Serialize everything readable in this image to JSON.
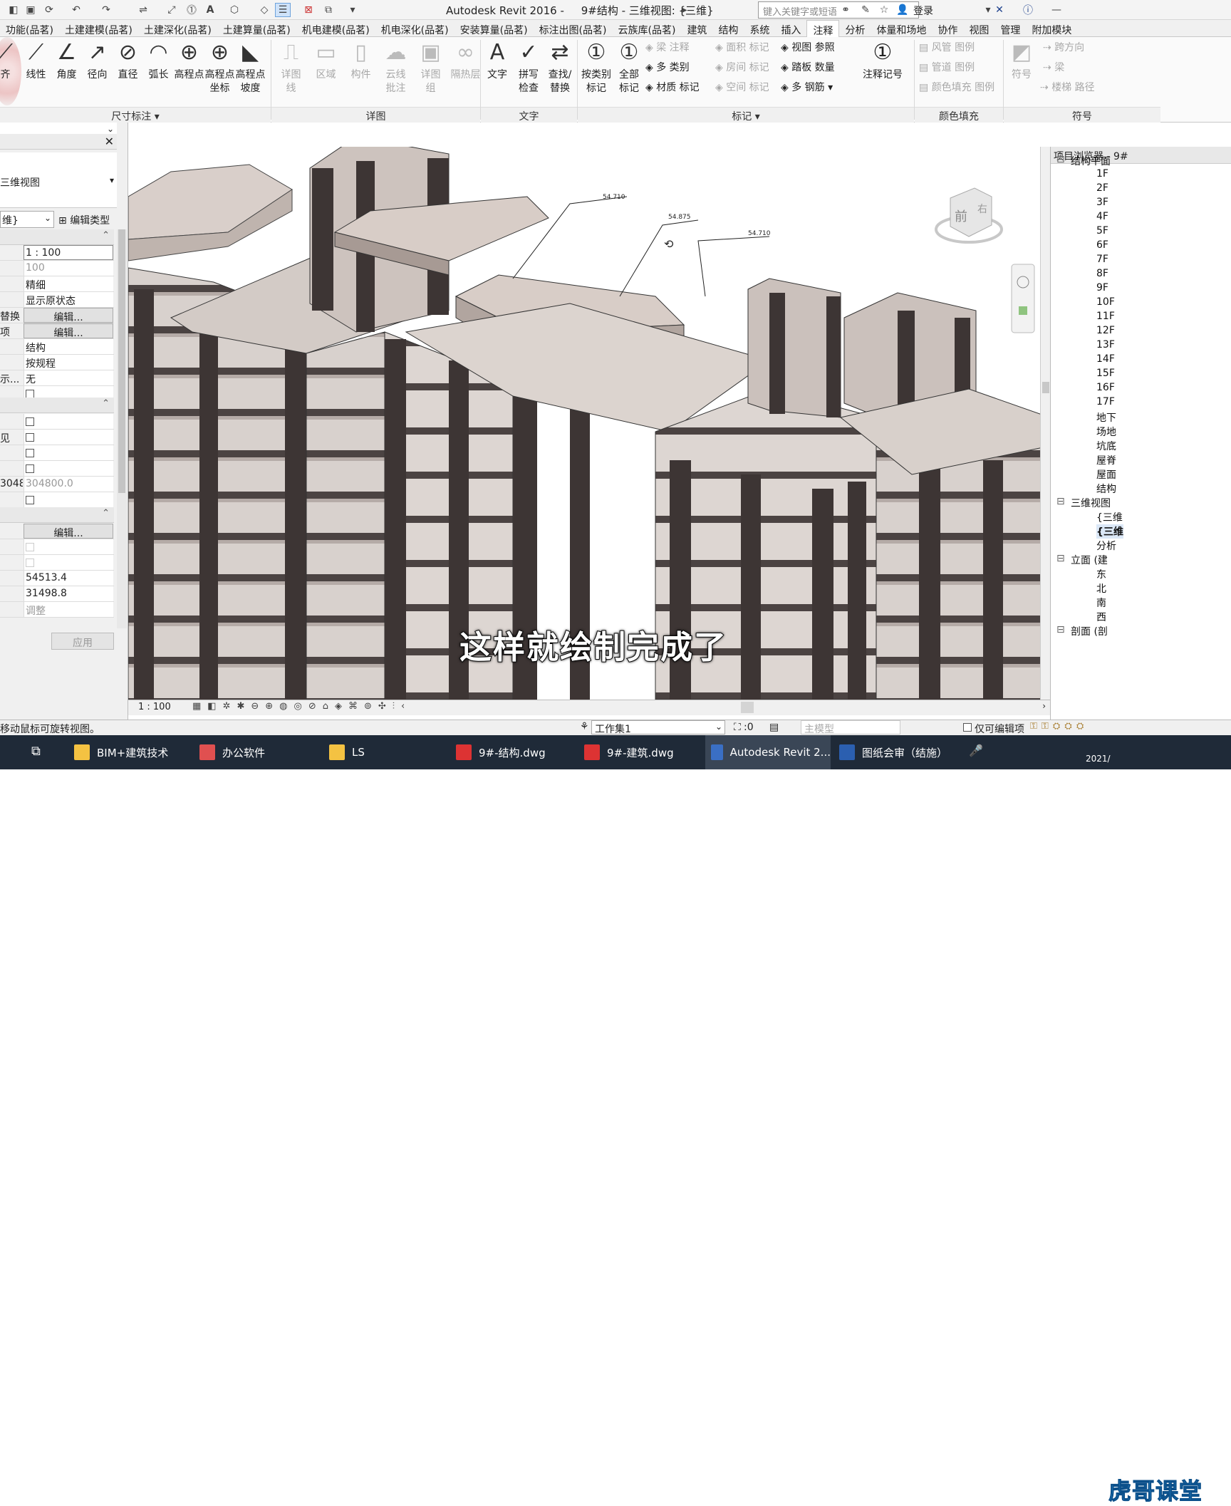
{
  "titlebar": {
    "title": "Autodesk Revit 2016 -     9#结构 - 三维视图: {三维}",
    "search_placeholder": "键入关键字或短语",
    "login_label": "登录"
  },
  "tabs": [
    "功能(品茗)",
    "土建建模(品茗)",
    "土建深化(品茗)",
    "土建算量(品茗)",
    "机电建模(品茗)",
    "机电深化(品茗)",
    "安装算量(品茗)",
    "标注出图(品茗)",
    "云族库(品茗)",
    "建筑",
    "结构",
    "系统",
    "插入",
    "注释",
    "分析",
    "体量和场地",
    "协作",
    "视图",
    "管理",
    "附加模块"
  ],
  "active_tab": "注释",
  "ribbon": {
    "dimension": {
      "buttons": [
        "齐",
        "线性",
        "角度",
        "径向",
        "直径",
        "弧长",
        "高程点",
        "高程点\n坐标",
        "高程点\n坡度"
      ],
      "panel_label": "尺寸标注 ▾"
    },
    "detail": {
      "buttons": [
        "详图\n线",
        "区域",
        "构件",
        "云线\n批注",
        "详图\n组",
        "隔热层"
      ],
      "panel_label": "详图"
    },
    "text": {
      "buttons": [
        "文字",
        "拼写\n检查",
        "查找/\n替换"
      ],
      "panel_label": "文字"
    },
    "tag": {
      "buttons": [
        "按类别\n标记",
        "全部\n标记"
      ],
      "small_a": [
        "梁 注释",
        "多 类别",
        "材质 标记"
      ],
      "small_b": [
        "面积 标记",
        "房间 标记",
        "空间 标记"
      ],
      "small_c": [
        "视图 参照",
        "踏板 数量",
        "多 钢筋 ▾"
      ],
      "big": "注释记号",
      "panel_label": "标记 ▾"
    },
    "color_fill": {
      "items": [
        "风管 图例",
        "管道 图例",
        "颜色填充 图例"
      ],
      "panel_label": "颜色填充"
    },
    "symbol": {
      "big": "符号",
      "items": [
        "跨方向",
        "梁",
        "楼梯 路径"
      ],
      "panel_label": "符号"
    }
  },
  "properties": {
    "type_name": "三维视图",
    "view_selector": "维}",
    "edit_type": "编辑类型",
    "rows": [
      {
        "key": "",
        "val": "1 : 100",
        "kind": "input"
      },
      {
        "key": "",
        "val": "100",
        "kind": "gray"
      },
      {
        "key": "",
        "val": "精细",
        "kind": "text"
      },
      {
        "key": "",
        "val": "显示原状态",
        "kind": "text"
      },
      {
        "key": "替换",
        "val": "编辑...",
        "kind": "btn"
      },
      {
        "key": "项",
        "val": "编辑...",
        "kind": "btn"
      },
      {
        "key": "",
        "val": "结构",
        "kind": "text"
      },
      {
        "key": "",
        "val": "按规程",
        "kind": "text"
      },
      {
        "key": "示...",
        "val": "无",
        "kind": "text"
      }
    ],
    "section2_rows": [
      "",
      "见",
      "",
      "",
      "304800.0",
      ""
    ],
    "edit_btn": "编辑...",
    "num1": "54513.4",
    "num2": "31498.8",
    "adjust": "调整",
    "apply": "应用"
  },
  "viewport": {
    "subtitle": "这样就绘制完成了",
    "elev_labels": [
      "54.710",
      "54.875",
      "54.710"
    ],
    "viewcube_front": "前",
    "viewcube_right": "右",
    "scale": "1 : 100"
  },
  "browser": {
    "title": "项目浏览器 - 9#",
    "items": [
      {
        "label": "结构平面",
        "indent": 0,
        "exp": "⊟"
      },
      {
        "label": "1F",
        "indent": 2
      },
      {
        "label": "2F",
        "indent": 2
      },
      {
        "label": "3F",
        "indent": 2
      },
      {
        "label": "4F",
        "indent": 2
      },
      {
        "label": "5F",
        "indent": 2
      },
      {
        "label": "6F",
        "indent": 2
      },
      {
        "label": "7F",
        "indent": 2
      },
      {
        "label": "8F",
        "indent": 2
      },
      {
        "label": "9F",
        "indent": 2
      },
      {
        "label": "10F",
        "indent": 2
      },
      {
        "label": "11F",
        "indent": 2
      },
      {
        "label": "12F",
        "indent": 2
      },
      {
        "label": "13F",
        "indent": 2
      },
      {
        "label": "14F",
        "indent": 2
      },
      {
        "label": "15F",
        "indent": 2
      },
      {
        "label": "16F",
        "indent": 2
      },
      {
        "label": "17F",
        "indent": 2
      },
      {
        "label": "地下",
        "indent": 2
      },
      {
        "label": "场地",
        "indent": 2
      },
      {
        "label": "坑底",
        "indent": 2
      },
      {
        "label": "屋脊",
        "indent": 2
      },
      {
        "label": "屋面",
        "indent": 2
      },
      {
        "label": "结构",
        "indent": 2
      },
      {
        "label": "三维视图",
        "indent": 0,
        "exp": "⊟"
      },
      {
        "label": "{三维",
        "indent": 2
      },
      {
        "label": "{三维",
        "indent": 2,
        "bold": true
      },
      {
        "label": "分析",
        "indent": 2
      },
      {
        "label": "立面 (建",
        "indent": 0,
        "exp": "⊟"
      },
      {
        "label": "东",
        "indent": 2
      },
      {
        "label": "北",
        "indent": 2
      },
      {
        "label": "南",
        "indent": 2
      },
      {
        "label": "西",
        "indent": 2
      },
      {
        "label": "剖面 (剖",
        "indent": 0,
        "exp": "⊟"
      }
    ]
  },
  "statusbar": {
    "hint": "移动鼠标可旋转视图。",
    "workset": "工作集1",
    "sel": ":0",
    "model": "主模型",
    "editable": "仅可编辑项"
  },
  "taskbar": {
    "items": [
      {
        "label": "BIM+建筑技术",
        "color": "#f4c242"
      },
      {
        "label": "办公软件",
        "color": "#e05050"
      },
      {
        "label": "LS",
        "color": "#f4c242"
      },
      {
        "label": "9#-结构.dwg",
        "color": "#d33"
      },
      {
        "label": "9#-建筑.dwg",
        "color": "#d33"
      },
      {
        "label": "Autodesk Revit 2...",
        "color": "#3a6fc4"
      },
      {
        "label": "图纸会审（结施）",
        "color": "#2b5fb0"
      }
    ],
    "date": "2021/"
  },
  "watermark": "虎哥课堂"
}
